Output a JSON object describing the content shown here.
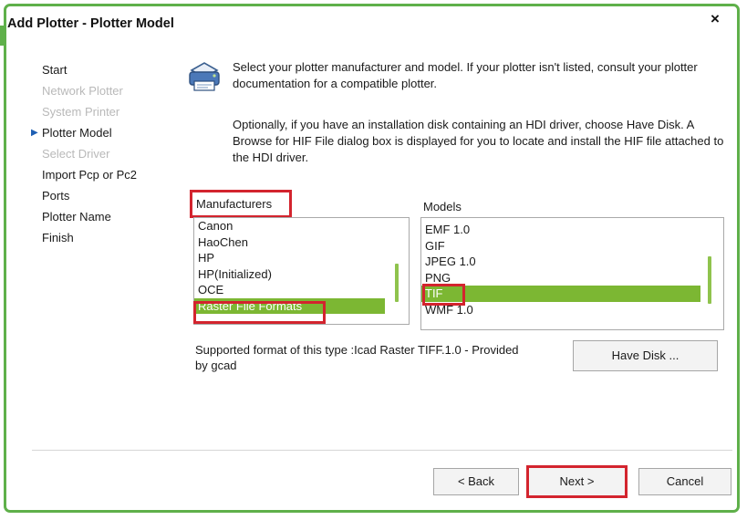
{
  "dialog": {
    "title": "Add Plotter - Plotter Model",
    "close_glyph": "×"
  },
  "steps": [
    {
      "label": "Start",
      "state": "normal"
    },
    {
      "label": "Network Plotter",
      "state": "disabled"
    },
    {
      "label": "System Printer",
      "state": "disabled"
    },
    {
      "label": "Plotter Model",
      "state": "current"
    },
    {
      "label": "Select Driver",
      "state": "disabled"
    },
    {
      "label": "Import Pcp or Pc2",
      "state": "normal"
    },
    {
      "label": "Ports",
      "state": "normal"
    },
    {
      "label": "Plotter Name",
      "state": "normal"
    },
    {
      "label": "Finish",
      "state": "normal"
    }
  ],
  "content": {
    "icon": "plotter-icon",
    "paragraph1": "Select your plotter manufacturer and model. If your plotter isn't listed, consult your plotter documentation for a compatible plotter.",
    "paragraph2": "Optionally, if you have an installation disk containing an HDI driver, choose Have Disk. A Browse for HIF File dialog box is displayed for you to locate and install the HIF file attached to the HDI driver."
  },
  "manufacturers": {
    "label": "Manufacturers",
    "items": [
      "Canon",
      "HaoChen",
      "HP",
      "HP(Initialized)",
      "OCE",
      "Raster File Formats"
    ],
    "selected": "Raster File Formats"
  },
  "models": {
    "label": "Models",
    "items": [
      "EMF 1.0",
      "GIF",
      "JPEG 1.0",
      "PNG",
      "TIF",
      "WMF 1.0"
    ],
    "selected": "TIF"
  },
  "supported_text": "Supported format of this type :Icad Raster TIFF.1.0 - Provided by gcad",
  "buttons": {
    "have_disk": "Have Disk ...",
    "back": "< Back",
    "next": "Next >",
    "cancel": "Cancel"
  },
  "colors": {
    "accent_green": "#5fb04a",
    "selection_green": "#7cb733",
    "highlight_red": "#d3242e"
  }
}
